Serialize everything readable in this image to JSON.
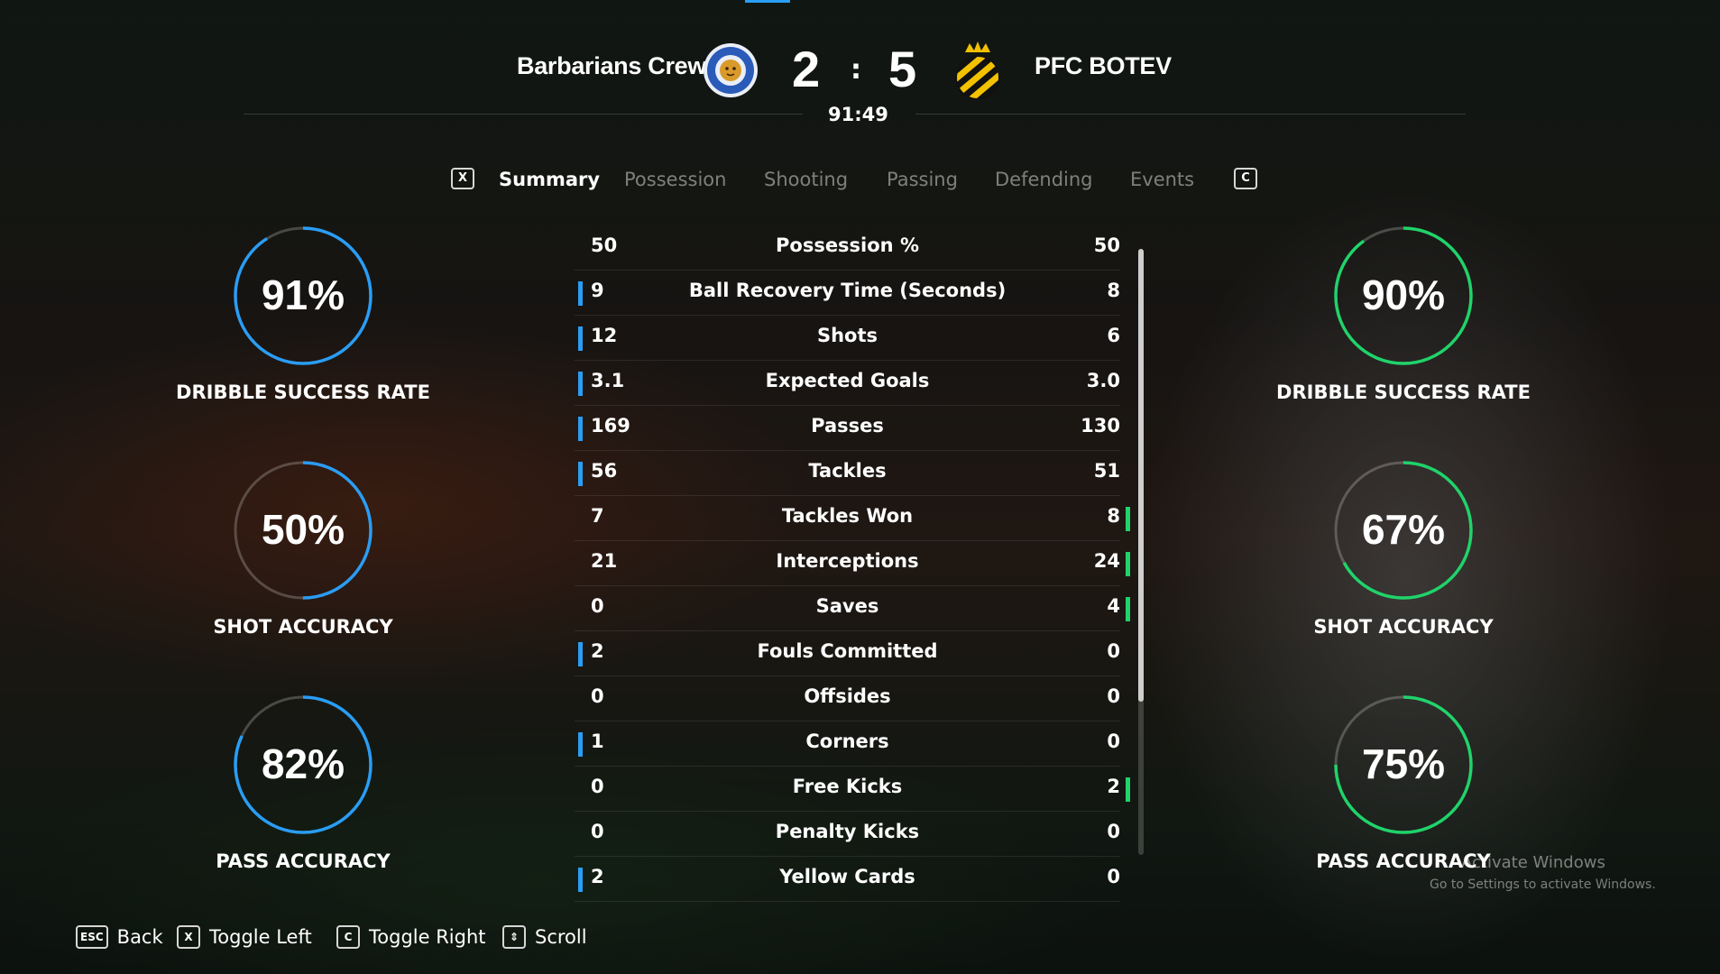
{
  "header": {
    "home_team": "Barbarians Crew",
    "away_team": "PFC BOTEV",
    "home_score": "2",
    "away_score": "5",
    "separator": ":",
    "clock": "91:49",
    "home_crest_icon": "lion-crest-icon",
    "away_crest_icon": "crowned-striped-crest-icon"
  },
  "tabs": {
    "left_key": "X",
    "right_key": "C",
    "items": [
      {
        "label": "Summary",
        "active": true
      },
      {
        "label": "Possession",
        "active": false
      },
      {
        "label": "Shooting",
        "active": false
      },
      {
        "label": "Passing",
        "active": false
      },
      {
        "label": "Defending",
        "active": false
      },
      {
        "label": "Events",
        "active": false
      }
    ]
  },
  "home_rings": [
    {
      "value": "91%",
      "label": "DRIBBLE SUCCESS RATE",
      "percent": 91
    },
    {
      "value": "50%",
      "label": "SHOT ACCURACY",
      "percent": 50
    },
    {
      "value": "82%",
      "label": "PASS ACCURACY",
      "percent": 82
    }
  ],
  "away_rings": [
    {
      "value": "90%",
      "label": "DRIBBLE SUCCESS RATE",
      "percent": 90
    },
    {
      "value": "67%",
      "label": "SHOT ACCURACY",
      "percent": 67
    },
    {
      "value": "75%",
      "label": "PASS ACCURACY",
      "percent": 75
    }
  ],
  "colors": {
    "home_accent": "#2a9df4",
    "away_accent": "#20d36a"
  },
  "stats": [
    {
      "label": "Possession %",
      "home": "50",
      "away": "50",
      "lead": "none"
    },
    {
      "label": "Ball Recovery Time (Seconds)",
      "home": "9",
      "away": "8",
      "lead": "home"
    },
    {
      "label": "Shots",
      "home": "12",
      "away": "6",
      "lead": "home"
    },
    {
      "label": "Expected Goals",
      "home": "3.1",
      "away": "3.0",
      "lead": "home"
    },
    {
      "label": "Passes",
      "home": "169",
      "away": "130",
      "lead": "home"
    },
    {
      "label": "Tackles",
      "home": "56",
      "away": "51",
      "lead": "home"
    },
    {
      "label": "Tackles Won",
      "home": "7",
      "away": "8",
      "lead": "away"
    },
    {
      "label": "Interceptions",
      "home": "21",
      "away": "24",
      "lead": "away"
    },
    {
      "label": "Saves",
      "home": "0",
      "away": "4",
      "lead": "away"
    },
    {
      "label": "Fouls Committed",
      "home": "2",
      "away": "0",
      "lead": "home"
    },
    {
      "label": "Offsides",
      "home": "0",
      "away": "0",
      "lead": "none"
    },
    {
      "label": "Corners",
      "home": "1",
      "away": "0",
      "lead": "home"
    },
    {
      "label": "Free Kicks",
      "home": "0",
      "away": "2",
      "lead": "away"
    },
    {
      "label": "Penalty Kicks",
      "home": "0",
      "away": "0",
      "lead": "none"
    },
    {
      "label": "Yellow Cards",
      "home": "2",
      "away": "0",
      "lead": "home"
    }
  ],
  "footer": [
    {
      "key": "ESC",
      "label": "Back"
    },
    {
      "key": "X",
      "label": "Toggle Left"
    },
    {
      "key": "C",
      "label": "Toggle Right"
    },
    {
      "key": "⇕",
      "label": "Scroll"
    }
  ],
  "watermark": {
    "title": "Activate Windows",
    "subtitle": "Go to Settings to activate Windows."
  }
}
